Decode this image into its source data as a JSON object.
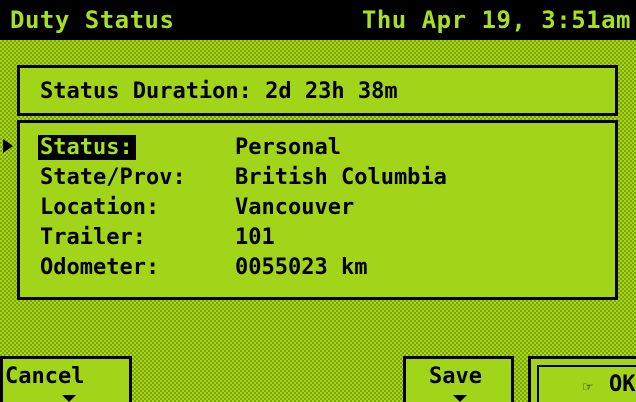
{
  "header": {
    "title": "Duty Status",
    "datetime": "Thu Apr 19, 3:51am"
  },
  "duration": {
    "label": "Status Duration: 2d 23h 38m"
  },
  "fields": [
    {
      "key": "Status:",
      "value": "Personal"
    },
    {
      "key": "State/Prov:",
      "value": "British Columbia"
    },
    {
      "key": "Location:",
      "value": "Vancouver"
    },
    {
      "key": "Trailer:",
      "value": "101"
    },
    {
      "key": "Odometer:",
      "value": "0055023 km"
    }
  ],
  "softkeys": {
    "cancel": "Cancel",
    "save": "Save",
    "ok": "OK",
    "ok_icon": "hand-pointer-icon"
  },
  "colors": {
    "background": "#9acd0e",
    "title_bar": "#000000",
    "title_text": "#a6e021"
  }
}
